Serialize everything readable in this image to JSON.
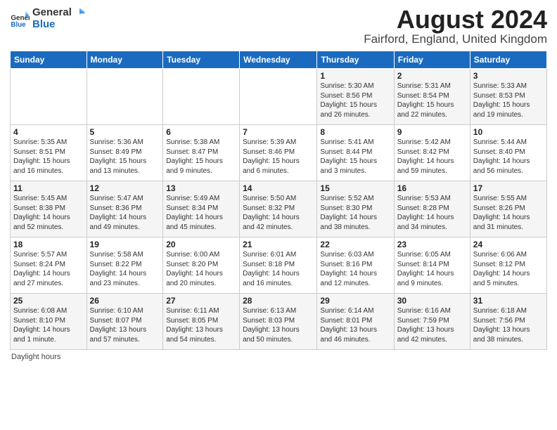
{
  "header": {
    "logo_general": "General",
    "logo_blue": "Blue",
    "title": "August 2024",
    "subtitle": "Fairford, England, United Kingdom"
  },
  "days_of_week": [
    "Sunday",
    "Monday",
    "Tuesday",
    "Wednesday",
    "Thursday",
    "Friday",
    "Saturday"
  ],
  "weeks": [
    [
      {
        "day": "",
        "info": ""
      },
      {
        "day": "",
        "info": ""
      },
      {
        "day": "",
        "info": ""
      },
      {
        "day": "",
        "info": ""
      },
      {
        "day": "1",
        "info": "Sunrise: 5:30 AM\nSunset: 8:56 PM\nDaylight: 15 hours\nand 26 minutes."
      },
      {
        "day": "2",
        "info": "Sunrise: 5:31 AM\nSunset: 8:54 PM\nDaylight: 15 hours\nand 22 minutes."
      },
      {
        "day": "3",
        "info": "Sunrise: 5:33 AM\nSunset: 8:53 PM\nDaylight: 15 hours\nand 19 minutes."
      }
    ],
    [
      {
        "day": "4",
        "info": "Sunrise: 5:35 AM\nSunset: 8:51 PM\nDaylight: 15 hours\nand 16 minutes."
      },
      {
        "day": "5",
        "info": "Sunrise: 5:36 AM\nSunset: 8:49 PM\nDaylight: 15 hours\nand 13 minutes."
      },
      {
        "day": "6",
        "info": "Sunrise: 5:38 AM\nSunset: 8:47 PM\nDaylight: 15 hours\nand 9 minutes."
      },
      {
        "day": "7",
        "info": "Sunrise: 5:39 AM\nSunset: 8:46 PM\nDaylight: 15 hours\nand 6 minutes."
      },
      {
        "day": "8",
        "info": "Sunrise: 5:41 AM\nSunset: 8:44 PM\nDaylight: 15 hours\nand 3 minutes."
      },
      {
        "day": "9",
        "info": "Sunrise: 5:42 AM\nSunset: 8:42 PM\nDaylight: 14 hours\nand 59 minutes."
      },
      {
        "day": "10",
        "info": "Sunrise: 5:44 AM\nSunset: 8:40 PM\nDaylight: 14 hours\nand 56 minutes."
      }
    ],
    [
      {
        "day": "11",
        "info": "Sunrise: 5:45 AM\nSunset: 8:38 PM\nDaylight: 14 hours\nand 52 minutes."
      },
      {
        "day": "12",
        "info": "Sunrise: 5:47 AM\nSunset: 8:36 PM\nDaylight: 14 hours\nand 49 minutes."
      },
      {
        "day": "13",
        "info": "Sunrise: 5:49 AM\nSunset: 8:34 PM\nDaylight: 14 hours\nand 45 minutes."
      },
      {
        "day": "14",
        "info": "Sunrise: 5:50 AM\nSunset: 8:32 PM\nDaylight: 14 hours\nand 42 minutes."
      },
      {
        "day": "15",
        "info": "Sunrise: 5:52 AM\nSunset: 8:30 PM\nDaylight: 14 hours\nand 38 minutes."
      },
      {
        "day": "16",
        "info": "Sunrise: 5:53 AM\nSunset: 8:28 PM\nDaylight: 14 hours\nand 34 minutes."
      },
      {
        "day": "17",
        "info": "Sunrise: 5:55 AM\nSunset: 8:26 PM\nDaylight: 14 hours\nand 31 minutes."
      }
    ],
    [
      {
        "day": "18",
        "info": "Sunrise: 5:57 AM\nSunset: 8:24 PM\nDaylight: 14 hours\nand 27 minutes."
      },
      {
        "day": "19",
        "info": "Sunrise: 5:58 AM\nSunset: 8:22 PM\nDaylight: 14 hours\nand 23 minutes."
      },
      {
        "day": "20",
        "info": "Sunrise: 6:00 AM\nSunset: 8:20 PM\nDaylight: 14 hours\nand 20 minutes."
      },
      {
        "day": "21",
        "info": "Sunrise: 6:01 AM\nSunset: 8:18 PM\nDaylight: 14 hours\nand 16 minutes."
      },
      {
        "day": "22",
        "info": "Sunrise: 6:03 AM\nSunset: 8:16 PM\nDaylight: 14 hours\nand 12 minutes."
      },
      {
        "day": "23",
        "info": "Sunrise: 6:05 AM\nSunset: 8:14 PM\nDaylight: 14 hours\nand 9 minutes."
      },
      {
        "day": "24",
        "info": "Sunrise: 6:06 AM\nSunset: 8:12 PM\nDaylight: 14 hours\nand 5 minutes."
      }
    ],
    [
      {
        "day": "25",
        "info": "Sunrise: 6:08 AM\nSunset: 8:10 PM\nDaylight: 14 hours\nand 1 minute."
      },
      {
        "day": "26",
        "info": "Sunrise: 6:10 AM\nSunset: 8:07 PM\nDaylight: 13 hours\nand 57 minutes."
      },
      {
        "day": "27",
        "info": "Sunrise: 6:11 AM\nSunset: 8:05 PM\nDaylight: 13 hours\nand 54 minutes."
      },
      {
        "day": "28",
        "info": "Sunrise: 6:13 AM\nSunset: 8:03 PM\nDaylight: 13 hours\nand 50 minutes."
      },
      {
        "day": "29",
        "info": "Sunrise: 6:14 AM\nSunset: 8:01 PM\nDaylight: 13 hours\nand 46 minutes."
      },
      {
        "day": "30",
        "info": "Sunrise: 6:16 AM\nSunset: 7:59 PM\nDaylight: 13 hours\nand 42 minutes."
      },
      {
        "day": "31",
        "info": "Sunrise: 6:18 AM\nSunset: 7:56 PM\nDaylight: 13 hours\nand 38 minutes."
      }
    ]
  ],
  "footer": "Daylight hours"
}
